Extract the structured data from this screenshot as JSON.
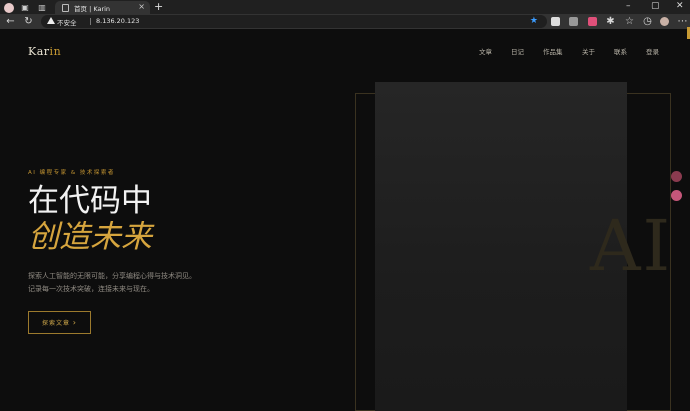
{
  "browser": {
    "tab_title": "首页 | Karin",
    "new_tab": "+",
    "close": "×",
    "insecure_label": "不安全",
    "url": "8.136.20.123"
  },
  "site": {
    "logo_main": "Kar",
    "logo_accent": "in",
    "nav": [
      "文章",
      "日记",
      "作品集",
      "关于",
      "联系",
      "登录"
    ]
  },
  "hero": {
    "tagline": "AI 编程专家 & 技术探索者",
    "title_line1": "在代码中",
    "title_line2": "创造未来",
    "description": "探索人工智能的无限可能，分享编程心得与技术洞见。记录每一次技术突破，连接未来与现在。",
    "cta_label": "探索文章",
    "cta_icon": "chevron-right-icon",
    "watermark": "AI"
  },
  "colors": {
    "accent": "#c79a33",
    "background": "#0d0d0d"
  }
}
